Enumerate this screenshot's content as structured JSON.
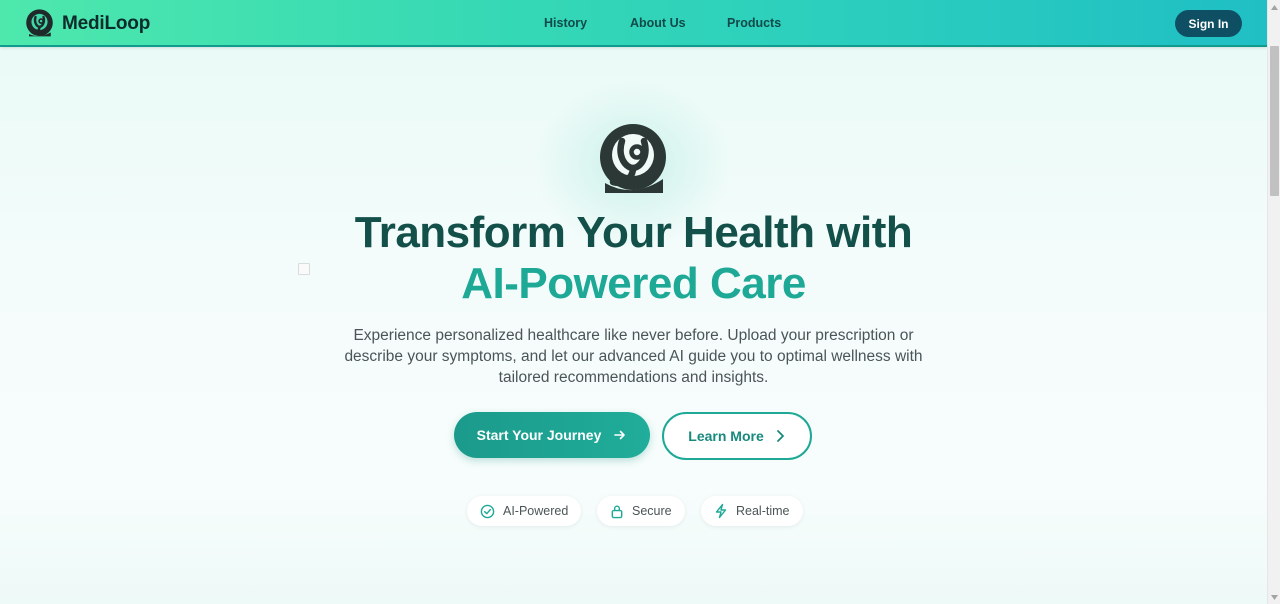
{
  "brand": {
    "name": "MediLoop",
    "logo_icon": "stethoscope-loop-icon"
  },
  "nav": {
    "items": [
      {
        "label": "History"
      },
      {
        "label": "About Us"
      },
      {
        "label": "Products"
      }
    ]
  },
  "header": {
    "signin_label": "Sign In"
  },
  "hero": {
    "logo_icon": "stethoscope-loop-icon",
    "title_line1": "Transform Your Health with",
    "title_line2": "AI-Powered Care",
    "description": "Experience personalized healthcare like never before. Upload your prescription or describe your symptoms, and let our advanced AI guide you to optimal wellness with tailored recommendations and insights.",
    "primary_button": {
      "label": "Start Your Journey",
      "icon": "arrow-right-icon"
    },
    "secondary_button": {
      "label": "Learn More",
      "icon": "chevron-right-icon"
    },
    "features": [
      {
        "label": "AI-Powered",
        "icon": "check-circle-icon"
      },
      {
        "label": "Secure",
        "icon": "lock-icon"
      },
      {
        "label": "Real-time",
        "icon": "lightning-icon"
      }
    ]
  },
  "colors": {
    "header_gradient_start": "#4ee8ad",
    "header_gradient_end": "#1fbfc4",
    "title_dark": "#13504a",
    "title_accent": "#1ea896",
    "signin_bg": "#0f4f63",
    "primary_button": "#1b9a8b"
  }
}
